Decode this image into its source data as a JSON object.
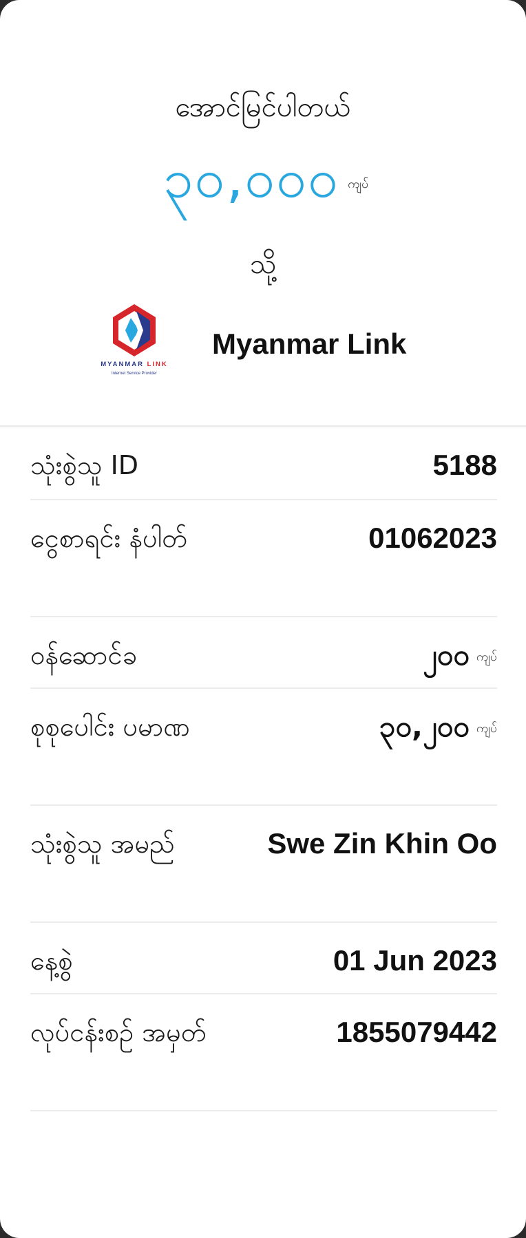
{
  "header": {
    "status": "အောင်မြင်ပါတယ်",
    "amount": "၃၀,၀၀၀",
    "amount_unit": "ကျပ်",
    "to_label": "သို့"
  },
  "merchant": {
    "logo_brand_left": "MYANMAR",
    "logo_brand_right": "LINK",
    "logo_tagline": "Internet Service Provider",
    "name": "Myanmar Link",
    "logo_colors": [
      "#d7262b",
      "#2a3a8c",
      "#29a8e0"
    ]
  },
  "details": {
    "user_id_label": "သုံးစွဲသူ ID",
    "user_id_value": "5188",
    "bill_number_label": "ငွေစာရင်း နံပါတ်",
    "bill_number_value": "01062023",
    "service_fee_label": "ဝန်ဆောင်ခ",
    "service_fee_value": "၂၀၀",
    "service_fee_unit": "ကျပ်",
    "total_label": "စုစုပေါင်း ပမာဏ",
    "total_value": "၃၀,၂၀၀",
    "total_unit": "ကျပ်",
    "user_name_label": "သုံးစွဲသူ အမည်",
    "user_name_value": "Swe Zin Khin Oo",
    "date_label": "နေ့စွဲ",
    "date_value": "01 Jun 2023",
    "transaction_id_label": "လုပ်ငန်းစဉ် အမှတ်",
    "transaction_id_value": "1855079442"
  },
  "colors": {
    "accent": "#29a8e0",
    "background": "#ffffff",
    "divider": "#ebebeb"
  }
}
